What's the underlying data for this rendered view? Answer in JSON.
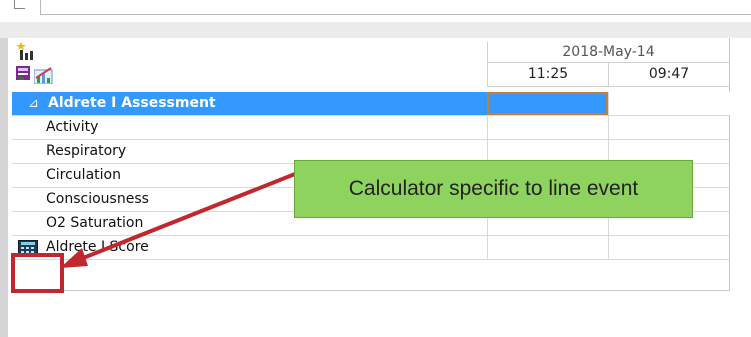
{
  "header": {
    "date": "2018-May-14",
    "times": [
      "11:25",
      "09:47"
    ]
  },
  "section": {
    "label": "Aldrete I Assessment",
    "expander_glyph": "⊿"
  },
  "rows": [
    {
      "label": "Activity"
    },
    {
      "label": "Respiratory"
    },
    {
      "label": "Circulation"
    },
    {
      "label": "Consciousness"
    },
    {
      "label": "O2 Saturation"
    },
    {
      "label": "Aldrete I Score",
      "icon": "calculator-icon"
    }
  ],
  "callout": {
    "text": "Calculator specific to line event"
  },
  "icons": {
    "top_left": "new-event-icon",
    "chart": "chart-icon",
    "flowsheet": "flowsheet-icon",
    "row_calculator": "calculator-icon"
  },
  "colors": {
    "selection": "#3399ff",
    "callout_bg": "#8fd35f",
    "highlight": "#c0282d",
    "active_cell_border": "#c87d38"
  }
}
